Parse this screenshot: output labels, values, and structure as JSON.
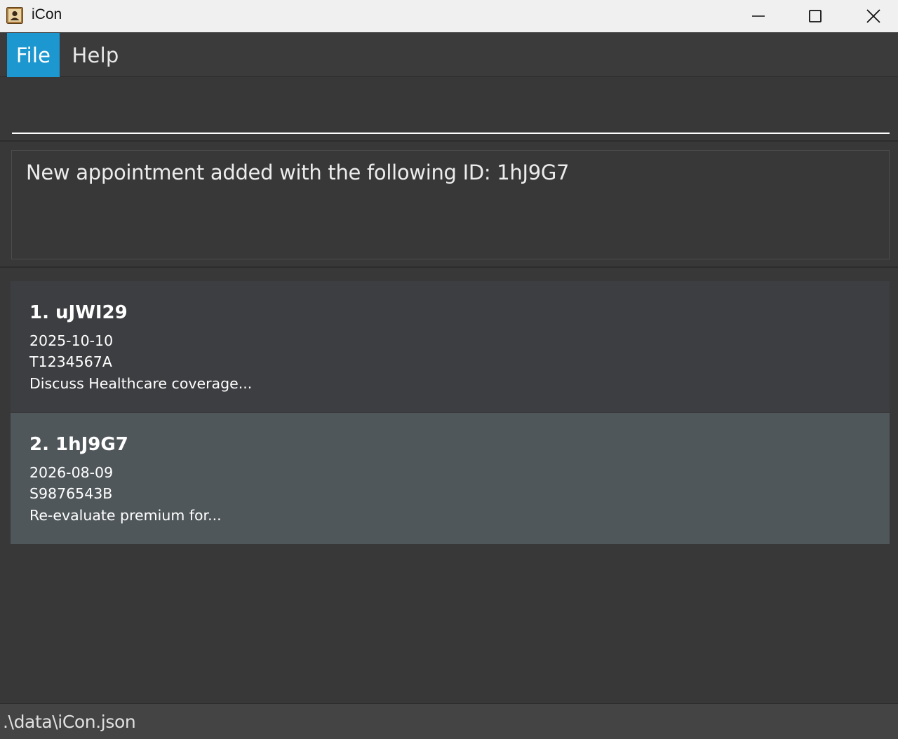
{
  "window": {
    "title": "iCon",
    "icon": "contact-book-icon"
  },
  "menu": {
    "items": [
      {
        "label": "File",
        "active": true
      },
      {
        "label": "Help",
        "active": false
      }
    ]
  },
  "command": {
    "value": "",
    "placeholder": ""
  },
  "result": {
    "message": "New appointment added with the following ID: 1hJ9G7"
  },
  "appointments": [
    {
      "title": "1. uJWI29",
      "date": "2025-10-10",
      "nric": "T1234567A",
      "description": "Discuss Healthcare coverage..."
    },
    {
      "title": "2. 1hJ9G7",
      "date": "2026-08-09",
      "nric": "S9876543B",
      "description": "Re-evaluate premium for..."
    }
  ],
  "status": {
    "file_path": ".\\data\\iCon.json"
  },
  "colors": {
    "accent": "#1c97cf",
    "background": "#383838",
    "card": "#3d3e41",
    "card_selected": "#50575b"
  }
}
